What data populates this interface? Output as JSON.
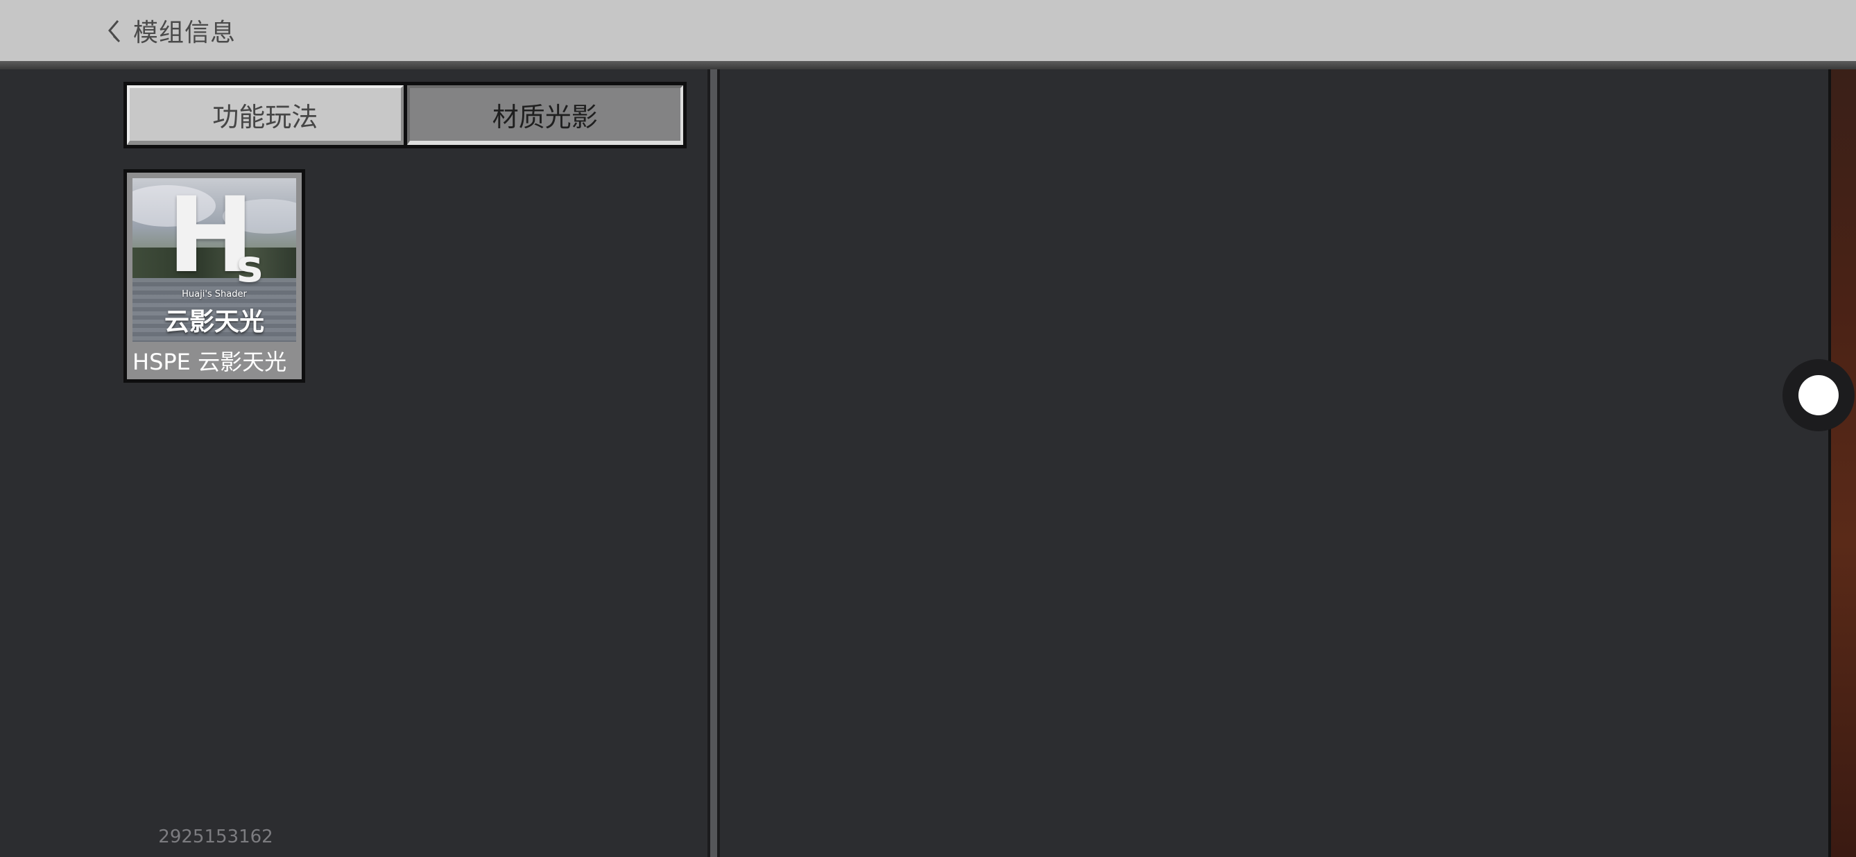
{
  "header": {
    "back_icon": "chevron-left-icon",
    "title": "模组信息"
  },
  "tabs": [
    {
      "label": "功能玩法",
      "state": "inactive"
    },
    {
      "label": "材质光影",
      "state": "active"
    }
  ],
  "mods": [
    {
      "thumbnail": {
        "logo_main": "H",
        "logo_sub": "s",
        "tagline": "Huaji's Shader",
        "title_cn": "云影天光"
      },
      "name": "HSPE 云影天光"
    }
  ],
  "footer": {
    "id": "2925153162"
  },
  "colors": {
    "topbar": "#c6c6c6",
    "background": "#2c2d30",
    "tab_inactive": "#c8c8c8",
    "tab_active": "#838384"
  }
}
